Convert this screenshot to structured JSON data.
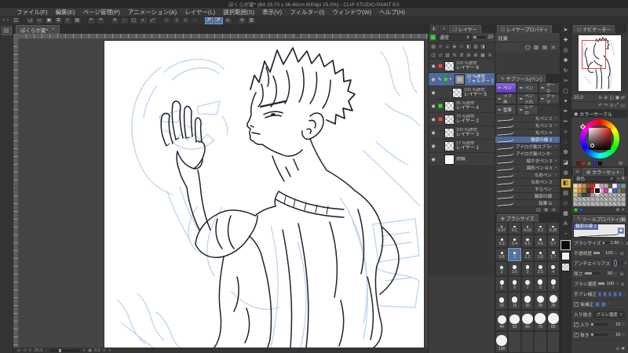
{
  "window": {
    "title": "ぼくらが夏* (B4 29.70 x 36.40cm 600dpi 25.0%) - CLIP STUDIO PAINT EX"
  },
  "menu": [
    "ファイル(F)",
    "編集(E)",
    "ページ管理(P)",
    "アニメーション(A)",
    "レイヤー(L)",
    "選択範囲(S)",
    "表示(V)",
    "フィルター(I)",
    "ウィンドウ(W)",
    "ヘルプ(H)"
  ],
  "command_bar": [
    {
      "name": "panel-toggle-icon",
      "glyph": "◫",
      "gap": true
    },
    {
      "name": "new-file-icon",
      "glyph": "❏"
    },
    {
      "name": "open-file-icon",
      "glyph": "▱"
    },
    {
      "name": "save-icon",
      "glyph": "▣"
    },
    {
      "name": "save-all-icon",
      "glyph": "⧉"
    },
    {
      "name": "export-icon",
      "glyph": "⇪"
    },
    {
      "name": "print-icon",
      "glyph": "▤",
      "gap": true
    },
    {
      "name": "undo-icon",
      "glyph": "↶"
    },
    {
      "name": "redo-icon",
      "glyph": "↷",
      "gap": true
    },
    {
      "name": "delete-icon",
      "glyph": "✕"
    },
    {
      "name": "deselect-icon",
      "glyph": "◌"
    },
    {
      "name": "select-all-icon",
      "glyph": "▢"
    },
    {
      "name": "invert-selection-icon",
      "glyph": "◐"
    },
    {
      "name": "scale-rotate-icon",
      "glyph": "⤢",
      "gap": true
    },
    {
      "name": "snap-ruler-icon",
      "glyph": "▨",
      "dim": true
    },
    {
      "name": "snap-special-ruler-icon",
      "glyph": "◨",
      "dim": true
    },
    {
      "name": "snap-grid-icon",
      "glyph": "▩",
      "dim": true
    },
    {
      "name": "snap-off-icon",
      "glyph": "□",
      "dim": true,
      "gap": true
    },
    {
      "name": "correct-line-icon",
      "glyph": "〆",
      "active": true
    },
    {
      "name": "correct-line-width-icon",
      "glyph": "〆",
      "active": true
    },
    {
      "name": "vector-snap-icon",
      "glyph": "∠",
      "gap": true
    },
    {
      "name": "no-snap-icon",
      "glyph": "⊘"
    },
    {
      "name": "settings-icon",
      "glyph": "▥"
    }
  ],
  "left_strip": {
    "icon_glyph": "▤",
    "icon_name": "material-panel-icon"
  },
  "canvas": {
    "tab": "ぼくらが夏*",
    "ruler_h": "10",
    "ruler_v": "10",
    "status_zoom": "25.0",
    "status_rotation": "0.0",
    "status_left_icons": [
      {
        "name": "flip-view-icon",
        "glyph": "⇄"
      },
      {
        "name": "rotate-left-view-icon",
        "glyph": "↺"
      },
      {
        "name": "rotate-right-view-icon",
        "glyph": "↻"
      }
    ],
    "zoom_out_glyph": "−",
    "zoom_in_glyph": "＋",
    "fit_glyph": "▣"
  },
  "layers_panel": {
    "tab": "レイヤー",
    "blend_mode": "通常",
    "opacity_value": "20",
    "command_icons_1": [
      "▧",
      "▪",
      "◒",
      "◈",
      "⌐",
      "◧",
      "▥",
      "◨"
    ],
    "command_icons_2": [
      "❏",
      "▱",
      "▥",
      "✎",
      "⇵",
      "⊟",
      "⊞",
      "▦",
      "✕"
    ],
    "layers": [
      {
        "mode_line": "100 %通常",
        "name": "レイヤー 8",
        "label": "red"
      },
      {
        "mode_line": "20 %通常",
        "name": "フォルダー 1",
        "label": "green",
        "selected": true,
        "folder": true,
        "editing": true
      },
      {
        "mode_line": "100 %通常",
        "name": "レイヤー 5",
        "indent": true
      },
      {
        "mode_line": "95 %通常",
        "name": "レイヤー 4",
        "label": "green"
      },
      {
        "mode_line": "75 %通常",
        "name": "レイヤー 2",
        "label": "red"
      },
      {
        "mode_line": "100 %通常",
        "name": "レイヤー 3"
      },
      {
        "mode_line": "17 %通常",
        "name": "レイヤー 1"
      },
      {
        "mode_line": "",
        "name": "用紙",
        "paper": true
      }
    ]
  },
  "layer_property": {
    "tab": "レイヤープロパティ",
    "effect_label": "効果",
    "icons": [
      {
        "name": "border-effect-icon",
        "glyph": "◯"
      },
      {
        "name": "tone-icon",
        "glyph": "▨"
      },
      {
        "name": "expression-color-icon",
        "glyph": "▤"
      },
      {
        "name": "dropdown-icon",
        "glyph": "∨"
      }
    ]
  },
  "subtool": {
    "tab": "サブツール[ペン]",
    "items": [
      {
        "label": "ペン",
        "selected": true
      },
      {
        "label": "ペン"
      },
      {
        "label": "マーカ"
      },
      {
        "label": "ラフ用"
      },
      {
        "label": "ペン入れ"
      },
      {
        "label": "グラフ"
      },
      {
        "label": "雲筆"
      },
      {
        "label": "レトロ"
      }
    ],
    "item_icon_glyph": "✒"
  },
  "brushes": {
    "items": [
      {
        "name": "丸ペン 2",
        "locked": true
      },
      {
        "name": "丸ペン 3",
        "locked": true
      },
      {
        "name": "丸ペン 4",
        "locked": false
      },
      {
        "name": "輪郭の線 3",
        "locked": true,
        "selected": true
      },
      {
        "name": "アナログ風カブラペンタイプ(PE-A2",
        "locked": true
      },
      {
        "name": "アナログ風ペンタイプ(PE-A 2",
        "locked": false
      },
      {
        "name": "絵かきペン 3",
        "locked": true
      },
      {
        "name": "図形ペン H 3",
        "locked": true
      },
      {
        "name": "なめペン",
        "locked": true
      },
      {
        "name": "なめペン 2",
        "locked": false
      },
      {
        "name": "すらペン",
        "locked": false
      },
      {
        "name": "輪郭の線",
        "locked": false
      },
      {
        "name": "鉛筆 G",
        "locked": false
      }
    ],
    "lock_glyph": "▪",
    "footer_icons": [
      {
        "name": "new-subtool-icon",
        "glyph": "❏"
      },
      {
        "name": "duplicate-subtool-icon",
        "glyph": "⧉"
      },
      {
        "name": "delete-subtool-icon",
        "glyph": "✕"
      }
    ]
  },
  "brush_size": {
    "tab": "ブラシサイズ",
    "values": [
      "0.07",
      "0.1",
      "0.15",
      "0.2",
      "0.25",
      "0.3",
      "0.4",
      "0.5",
      "0.6",
      "0.7",
      "0.8",
      "1",
      "1.2",
      "1.5",
      "1.7",
      "2",
      "2.5",
      "3",
      "3.5",
      "4",
      "5",
      "6",
      "7",
      "8",
      "9",
      "10",
      "15",
      "20",
      "25",
      "30",
      "40",
      "50",
      "60",
      "70",
      "80",
      "100"
    ],
    "selected": "1"
  },
  "tool_strip": [
    {
      "name": "operation-tool",
      "glyph": "➤"
    },
    {
      "name": "move-layer-tool",
      "glyph": "✚"
    },
    {
      "name": "zoom-tool",
      "glyph": "◎"
    },
    {
      "name": "hand-tool",
      "glyph": "✱"
    },
    {
      "name": "rotate-view-tool",
      "glyph": "↻"
    },
    {
      "name": "eyedropper-tool",
      "glyph": "✑"
    },
    {
      "name": "selection-tool",
      "glyph": "▢"
    },
    {
      "name": "auto-select-tool",
      "glyph": "✦"
    },
    {
      "name": "pen-tool",
      "glyph": "✒"
    },
    {
      "name": "pencil-tool",
      "glyph": "✏"
    },
    {
      "name": "brush-tool",
      "glyph": "≈"
    },
    {
      "name": "airbrush-tool",
      "glyph": "∴"
    },
    {
      "name": "decoration-tool",
      "glyph": "✿"
    },
    {
      "name": "eraser-tool",
      "glyph": "◪"
    },
    {
      "name": "blend-tool",
      "glyph": "◍"
    },
    {
      "name": "fill-tool",
      "glyph": "◧",
      "active": true
    },
    {
      "name": "gradient-tool",
      "glyph": "▤"
    },
    {
      "name": "figure-tool",
      "glyph": "◇"
    },
    {
      "name": "frame-border-tool",
      "glyph": "▦"
    },
    {
      "name": "text-tool",
      "glyph": "A"
    },
    {
      "name": "line-correct-tool",
      "glyph": "~"
    }
  ],
  "navigator": {
    "tab": "ナビゲーター",
    "zoom": "25.0",
    "controls1": [
      {
        "name": "zoom-out-icon",
        "glyph": "⊖"
      },
      {
        "name": "zoom-in-icon",
        "glyph": "⊕"
      },
      {
        "name": "fit-screen-icon",
        "glyph": "◱"
      },
      {
        "name": "actual-size-icon",
        "glyph": "◼"
      },
      {
        "name": "flip-horizontal-icon",
        "glyph": "⇄"
      }
    ],
    "controls2": [
      {
        "name": "rotate-left-icon",
        "glyph": "↶"
      },
      {
        "name": "rotate-right-icon",
        "glyph": "↷"
      },
      {
        "name": "reset-rotation-icon",
        "glyph": "⊙"
      },
      {
        "name": "reset-view-icon",
        "glyph": "⤢"
      },
      {
        "name": "subview-icon",
        "glyph": "▭"
      }
    ]
  },
  "color_circle": {
    "tab": "カラーサークル",
    "tab_icon": "◉",
    "history": [
      "#7a1f1f",
      "#d42a2a",
      "#2aa43c",
      "#2a38c8",
      "#141414"
    ],
    "add_glyph": "⊞"
  },
  "color_set": {
    "tab": "カラーセット",
    "set_name": "発色",
    "search_glyph": "⌕",
    "wrench_glyph": "✚",
    "colors": [
      "#ecd4cc",
      "#e8b48c",
      "#cc8a5a",
      "#8e4e34",
      "#d23028",
      "#f2f2f2",
      "#ea94b4",
      "#aaaaaa",
      "#5a5a5a",
      "#ffffff",
      "#9464c4",
      "#54aaa2",
      "#ead862",
      "#ea9434",
      "#8c8434",
      "#3a3a34",
      "#bc2c24",
      "#1a1a1a",
      "#eaa4c4",
      "#c444a4",
      "#fafafa",
      "#4c5cca",
      "#4ca44c",
      "#845434",
      "#ccbca4",
      "#7c8c5c",
      "#34445c",
      "#6e3e54",
      "#a4a4bc",
      "#dccab4",
      "",
      "",
      "",
      "",
      "",
      "",
      "",
      "",
      "",
      "",
      "",
      "",
      "",
      "",
      "",
      "",
      "",
      "",
      "",
      "",
      "",
      "",
      "",
      "",
      "",
      "",
      "",
      "",
      "",
      ""
    ],
    "selected_index": 17,
    "footer_chips": [
      "#3ec93e",
      "#3a50d4"
    ],
    "footer_icons": [
      {
        "name": "add-color-icon",
        "glyph": "⊞"
      },
      {
        "name": "delete-color-icon",
        "glyph": "✕"
      }
    ]
  },
  "tool_property": {
    "tab": "ツールプロパティ[輪郭の線 3]",
    "preview_name": "輪郭の線 3",
    "settings": [
      {
        "type": "slider",
        "label": "ブラシサイズ",
        "value": "1.80",
        "fill": 30
      },
      {
        "type": "slider",
        "label": "不透明度",
        "value": "100",
        "fill": 100
      },
      {
        "type": "chips",
        "label": "アンチエイリアス",
        "selected": 1,
        "count": 4
      },
      {
        "type": "slider",
        "label": "厚さ",
        "value": "50",
        "fill": 50
      },
      {
        "type": "slider",
        "label": "ブラシ濃度",
        "value": "100",
        "fill": 100
      },
      {
        "type": "stepper",
        "label": "手ブレ補正",
        "filled": 5
      },
      {
        "type": "stepper",
        "label": "後補正",
        "checkbox": true,
        "filled": 2
      },
      {
        "type": "dropdown",
        "label": "入り抜き",
        "value": "ブラシ濃度"
      },
      {
        "type": "checkslider",
        "label": "入り",
        "value": "10",
        "fill": 15
      },
      {
        "type": "checkslider",
        "label": "抜き",
        "value": "10",
        "fill": 15
      }
    ],
    "footer_icons": [
      {
        "name": "reset-tool-icon",
        "glyph": "⊙"
      },
      {
        "name": "detail-settings-icon",
        "glyph": "✱"
      }
    ]
  },
  "accent_colors": {
    "selection_blue": "#50699b",
    "active_yellow": "#d8b23a",
    "label_red": "#e04848",
    "label_green": "#43cf43",
    "sketch_blue": "#b7d1ee",
    "ink": "#22222e"
  }
}
